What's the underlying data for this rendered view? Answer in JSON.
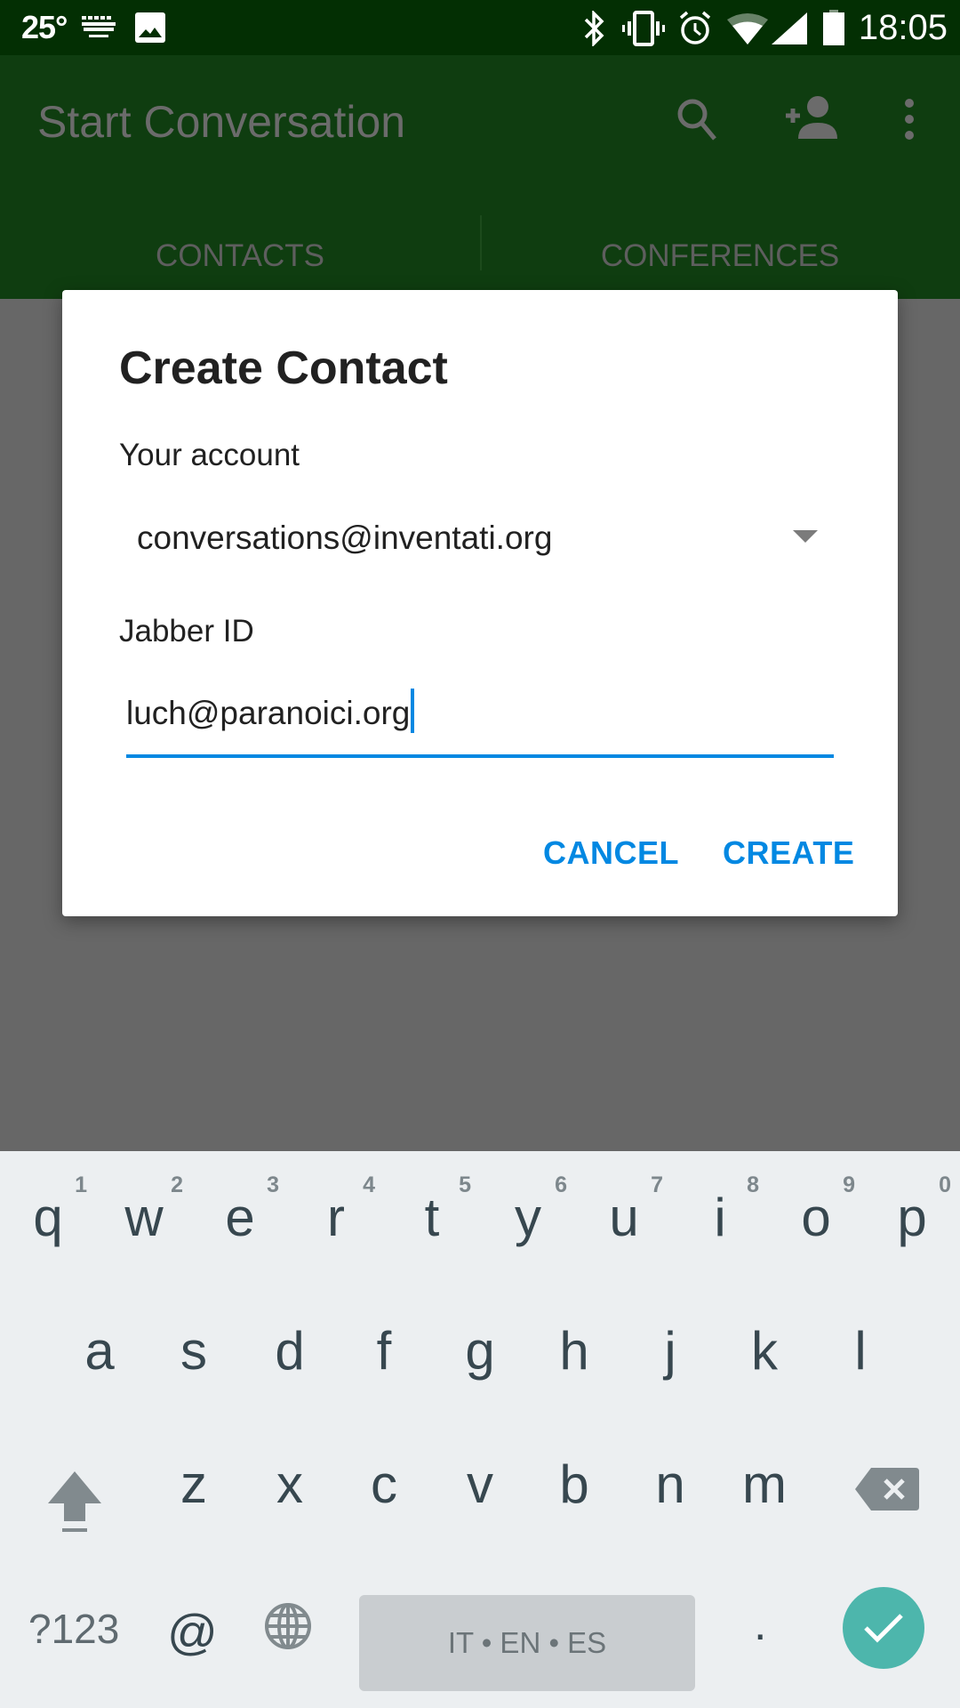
{
  "status_bar": {
    "temperature": "25°",
    "icons": [
      "keyboard-icon",
      "image-icon",
      "bluetooth-icon",
      "vibrate-icon",
      "alarm-icon",
      "wifi-icon",
      "signal-icon",
      "battery-icon"
    ],
    "time": "18:05"
  },
  "app_bar": {
    "title": "Start Conversation",
    "actions": [
      "search-icon",
      "add-contact-icon",
      "more-vert-icon"
    ],
    "tabs": [
      {
        "label": "CONTACTS",
        "selected": true
      },
      {
        "label": "CONFERENCES",
        "selected": false
      }
    ]
  },
  "dialog": {
    "title": "Create Contact",
    "account_label": "Your account",
    "account_value": "conversations@inventati.org",
    "jid_label": "Jabber ID",
    "jid_value": "luch@paranoici.org",
    "cancel_label": "CANCEL",
    "create_label": "CREATE",
    "accent_color": "#0288e2"
  },
  "keyboard": {
    "row1": [
      {
        "char": "q",
        "hint": "1"
      },
      {
        "char": "w",
        "hint": "2"
      },
      {
        "char": "e",
        "hint": "3"
      },
      {
        "char": "r",
        "hint": "4"
      },
      {
        "char": "t",
        "hint": "5"
      },
      {
        "char": "y",
        "hint": "6"
      },
      {
        "char": "u",
        "hint": "7"
      },
      {
        "char": "i",
        "hint": "8"
      },
      {
        "char": "o",
        "hint": "9"
      },
      {
        "char": "p",
        "hint": "0"
      }
    ],
    "row2": [
      "a",
      "s",
      "d",
      "f",
      "g",
      "h",
      "j",
      "k",
      "l"
    ],
    "row3": [
      "z",
      "x",
      "c",
      "v",
      "b",
      "n",
      "m"
    ],
    "symbols_label": "?123",
    "at_label": "@",
    "space_label": "IT • EN • ES",
    "period_label": ".",
    "enter_color": "#4db6ac"
  }
}
